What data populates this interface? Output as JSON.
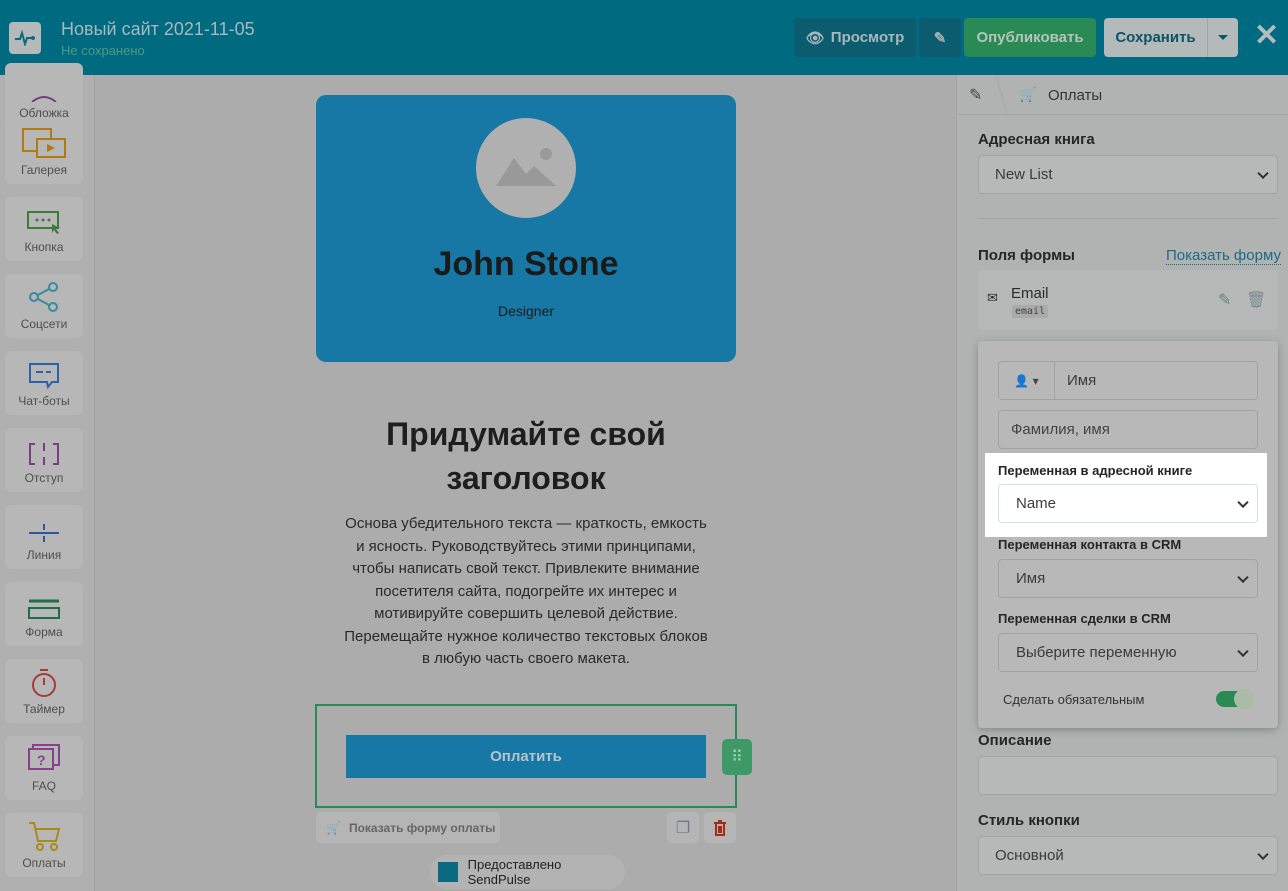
{
  "header": {
    "title": "Новый сайт 2021-11-05",
    "status": "Не сохранено",
    "preview": "Просмотр",
    "publish": "Опубликовать",
    "save": "Сохранить"
  },
  "sidebar": {
    "items": [
      "Обложка",
      "Галерея",
      "Кнопка",
      "Соцсети",
      "Чат-боты",
      "Отступ",
      "Линия",
      "Форма",
      "Таймер",
      "FAQ",
      "Оплаты"
    ]
  },
  "canvas": {
    "name": "John Stone",
    "role": "Designer",
    "heading": "Придумайте свой заголовок",
    "paragraph": "Основа убедительного текста — краткость, емкость и ясность. Руководствуйтесь этими принципами, чтобы написать свой текст. Привлеките внимание посетителя сайта, подогрейте их интерес и мотивируйте совершить целевой действие. Перемещайте нужное количество текстовых блоков в любую часть своего макета.",
    "pay_button": "Оплатить",
    "show_form": "Показать форму оплаты",
    "powered": "Предоставлено SendPulse"
  },
  "panel": {
    "breadcrumb": "Оплаты",
    "address_book_label": "Адресная книга",
    "address_book_value": "New List",
    "form_fields_label": "Поля формы",
    "show_form_link": "Показать форму",
    "field": {
      "name": "Email",
      "tag": "email"
    },
    "description_label": "Описание",
    "button_style_label": "Стиль кнопки",
    "button_style_value": "Основной"
  },
  "popup": {
    "field_name": "Имя",
    "placeholder": "Фамилия, имя",
    "ab_var_label": "Переменная в адресной книге",
    "ab_var_value": "Name",
    "crm_contact_label": "Переменная контакта в CRM",
    "crm_contact_value": "Имя",
    "crm_deal_label": "Переменная сделки в CRM",
    "crm_deal_value": "Выберите переменную",
    "required_label": "Сделать обязательным",
    "required": true
  },
  "colors": {
    "header": "#006a80",
    "publish": "#2a8a55",
    "card": "#1778a6",
    "highlight": "#ffffff"
  }
}
